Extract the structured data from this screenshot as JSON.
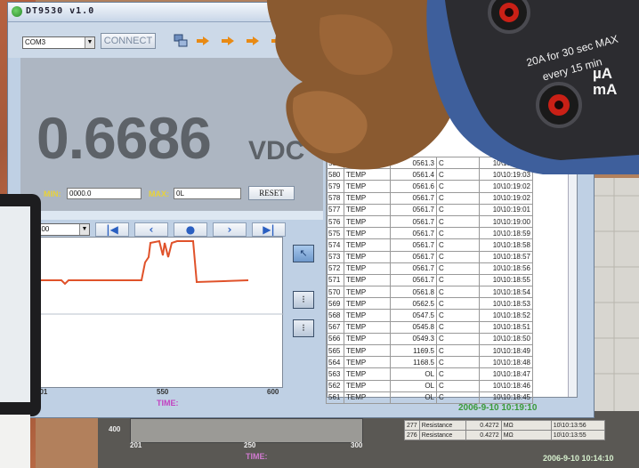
{
  "window": {
    "title": "DT9530 v1.0"
  },
  "toolbar": {
    "port": "COM3",
    "connect_label": "CONNECT",
    "icons": [
      "network-icon",
      "arrow-icon"
    ]
  },
  "display": {
    "reading": "0.6686",
    "unit": "VDC",
    "min_label": "MIN:",
    "min_value": "0000.0",
    "max_label": "MAX:",
    "max_value": "0L",
    "reset_label": "RESET"
  },
  "chart_nav": {
    "range": "500",
    "buttons": [
      "first",
      "prev",
      "record",
      "next",
      "last"
    ]
  },
  "chart": {
    "x_ticks": [
      "501",
      "550",
      "600"
    ],
    "time_label": "TIME:"
  },
  "log": {
    "rows": [
      [
        "581",
        "TEMP",
        "0561.3",
        "C",
        "10\\10:19:04"
      ],
      [
        "580",
        "TEMP",
        "0561.4",
        "C",
        "10\\10:19:03"
      ],
      [
        "579",
        "TEMP",
        "0561.6",
        "C",
        "10\\10:19:02"
      ],
      [
        "578",
        "TEMP",
        "0561.7",
        "C",
        "10\\10:19:02"
      ],
      [
        "577",
        "TEMP",
        "0561.7",
        "C",
        "10\\10:19:01"
      ],
      [
        "576",
        "TEMP",
        "0561.7",
        "C",
        "10\\10:19:00"
      ],
      [
        "575",
        "TEMP",
        "0561.7",
        "C",
        "10\\10:18:59"
      ],
      [
        "574",
        "TEMP",
        "0561.7",
        "C",
        "10\\10:18:58"
      ],
      [
        "573",
        "TEMP",
        "0561.7",
        "C",
        "10\\10:18:57"
      ],
      [
        "572",
        "TEMP",
        "0561.7",
        "C",
        "10\\10:18:56"
      ],
      [
        "571",
        "TEMP",
        "0561.7",
        "C",
        "10\\10:18:55"
      ],
      [
        "570",
        "TEMP",
        "0561.8",
        "C",
        "10\\10:18:54"
      ],
      [
        "569",
        "TEMP",
        "0562.5",
        "C",
        "10\\10:18:53"
      ],
      [
        "568",
        "TEMP",
        "0547.5",
        "C",
        "10\\10:18:52"
      ],
      [
        "567",
        "TEMP",
        "0545.8",
        "C",
        "10\\10:18:51"
      ],
      [
        "566",
        "TEMP",
        "0549.3",
        "C",
        "10\\10:18:50"
      ],
      [
        "565",
        "TEMP",
        "1169.5",
        "C",
        "10\\10:18:49"
      ],
      [
        "564",
        "TEMP",
        "1168.5",
        "C",
        "10\\10:18:48"
      ],
      [
        "563",
        "TEMP",
        "OL",
        "C",
        "10\\10:18:47"
      ],
      [
        "562",
        "TEMP",
        "OL",
        "C",
        "10\\10:18:46"
      ],
      [
        "561",
        "TEMP",
        "OL",
        "C",
        "10\\10:18:45"
      ]
    ]
  },
  "status": {
    "datetime": "2006-9-10 10:19:10"
  },
  "background_window": {
    "y_value": "400",
    "x_ticks": [
      "201",
      "250",
      "300"
    ],
    "time_label": "TIME:",
    "datetime": "2006-9-10 10:14:10",
    "rows": [
      [
        "277",
        "Resistance",
        "0.4272",
        "MΩ",
        "10\\10:13:56"
      ],
      [
        "276",
        "Resistance",
        "0.4272",
        "MΩ",
        "10\\10:13:55"
      ]
    ]
  },
  "meter": {
    "rating_line1": "20A for 30 sec MAX",
    "rating_line2": "every 15 min",
    "unit_ua": "µA",
    "unit_ma": "mA"
  },
  "colors": {
    "trace": "#e0522a",
    "accent_time": "#c242c0",
    "status_green": "#3a9a3a"
  }
}
